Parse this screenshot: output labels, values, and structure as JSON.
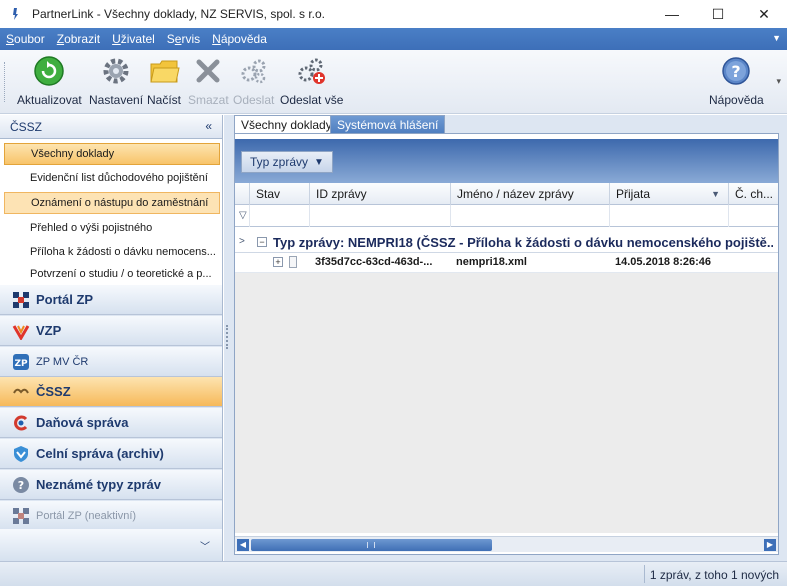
{
  "window": {
    "title": "PartnerLink - Všechny doklady, NZ SERVIS, spol. s r.o.",
    "controls": [
      "—",
      "☐",
      "✕"
    ]
  },
  "menu": {
    "items": [
      {
        "key": "S",
        "rest": "oubor"
      },
      {
        "key": "Z",
        "rest": "obrazit"
      },
      {
        "key": "U",
        "rest": "živatel"
      },
      {
        "pre": "S",
        "key": "e",
        "rest": "rvis"
      },
      {
        "key": "N",
        "rest": "ápověda"
      }
    ]
  },
  "toolbar": {
    "refresh_label": "Aktualizovat",
    "settings_label": "Nastavení",
    "load_label": "Načíst",
    "delete_label": "Smazat",
    "send_label": "Odeslat",
    "send_all_label": "Odeslat vše",
    "help_label": "Nápověda"
  },
  "nav": {
    "header": "ČSSZ",
    "collapse_glyph": "«",
    "sub_items": [
      {
        "label": "Všechny doklady"
      },
      {
        "label": "Evidenční list důchodového pojištění"
      },
      {
        "label": "Oznámení o nástupu do zaměstnání"
      },
      {
        "label": "Přehled o výši pojistného"
      },
      {
        "label": "Příloha k žádosti o dávku nemocens..."
      },
      {
        "label": "Potvrzení o studiu / o teoretické a p..."
      }
    ],
    "sections": [
      {
        "label": "Portál ZP"
      },
      {
        "label": "VZP"
      },
      {
        "label": "ZP MV ČR"
      },
      {
        "label": "ČSSZ"
      },
      {
        "label": "Daňová správa"
      },
      {
        "label": "Celní správa (archiv)"
      },
      {
        "label": "Neznámé typy zpráv"
      },
      {
        "label": "Portál ZP (neaktivní)"
      }
    ]
  },
  "tabs": {
    "all_docs": "Všechny doklady",
    "system_msgs": "Systémová hlášení"
  },
  "grid": {
    "group_chip": "Typ zprávy",
    "columns": [
      "Stav",
      "ID zprávy",
      "Jméno / název zprávy",
      "Přijata",
      "Č. ch..."
    ],
    "group_row": "Typ zprávy: NEMPRI18 (ČSSZ - Příloha k žádosti o dávku nemocenského pojiště...",
    "rows": [
      {
        "id": "3f35d7cc-63cd-463d-...",
        "name": "nempri18.xml",
        "received": "14.05.2018 8:26:46"
      }
    ]
  },
  "status": {
    "text": "1 zpráv, z toho 1 nových"
  },
  "colors": {
    "accent": "#3d6fb8",
    "highlight": "#f8c46a"
  }
}
